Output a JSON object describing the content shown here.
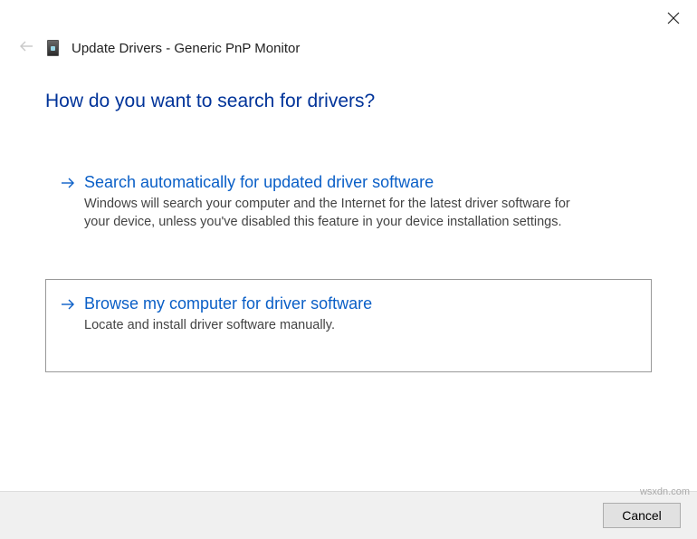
{
  "header": {
    "title": "Update Drivers - Generic PnP Monitor"
  },
  "heading": "How do you want to search for drivers?",
  "options": [
    {
      "title": "Search automatically for updated driver software",
      "desc": "Windows will search your computer and the Internet for the latest driver software for your device, unless you've disabled this feature in your device installation settings."
    },
    {
      "title": "Browse my computer for driver software",
      "desc": "Locate and install driver software manually."
    }
  ],
  "footer": {
    "cancel_label": "Cancel"
  },
  "watermark": "wsxdn.com"
}
